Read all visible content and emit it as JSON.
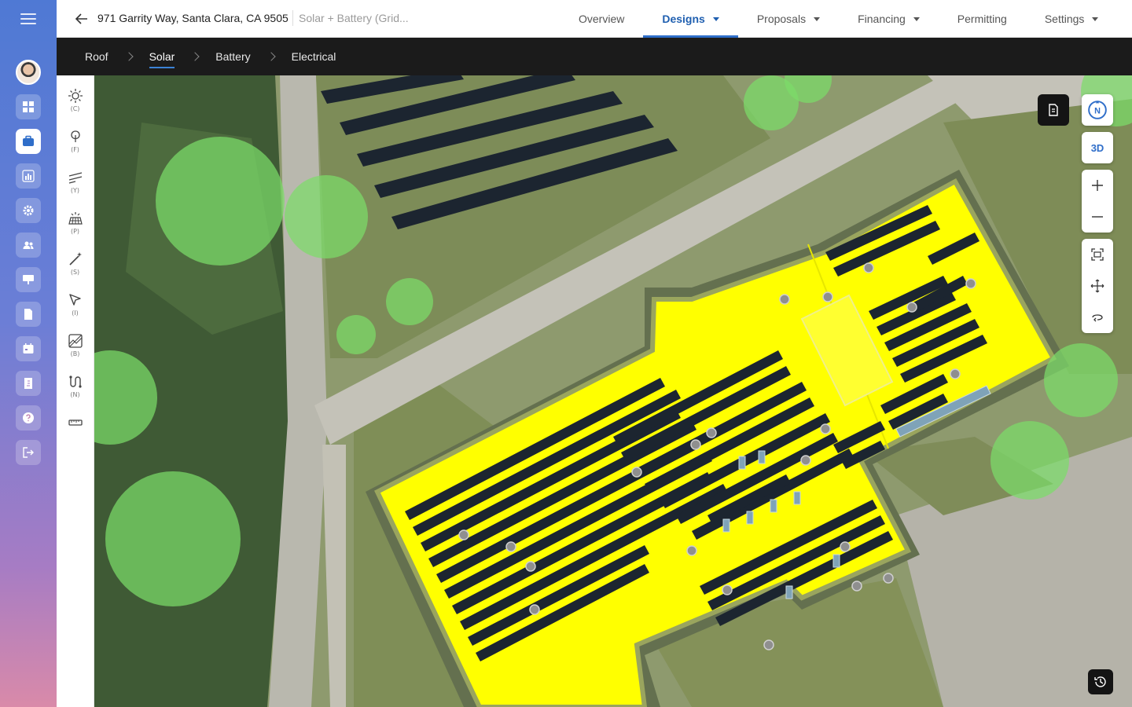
{
  "header": {
    "address": "971 Garrity Way, Santa Clara, CA 9505",
    "project": "Solar + Battery (Grid...",
    "tabs": [
      {
        "label": "Overview",
        "dropdown": false
      },
      {
        "label": "Designs",
        "dropdown": true,
        "active": true
      },
      {
        "label": "Proposals",
        "dropdown": true
      },
      {
        "label": "Financing",
        "dropdown": true
      },
      {
        "label": "Permitting",
        "dropdown": false
      },
      {
        "label": "Settings",
        "dropdown": true
      }
    ]
  },
  "subnav": {
    "steps": [
      "Roof",
      "Solar",
      "Battery",
      "Electrical"
    ],
    "active": "Solar"
  },
  "tools": [
    {
      "icon": "sun-icon",
      "key": "(C)"
    },
    {
      "icon": "tree-icon",
      "key": "(F)"
    },
    {
      "icon": "setback-lines-icon",
      "key": "(Y)"
    },
    {
      "icon": "solar-panel-icon",
      "key": "(P)"
    },
    {
      "icon": "magic-wand-icon",
      "key": "(S)"
    },
    {
      "icon": "select-cursor-icon",
      "key": "(I)"
    },
    {
      "icon": "irradiance-icon",
      "key": "(B)"
    },
    {
      "icon": "string-icon",
      "key": "(N)"
    },
    {
      "icon": "ruler-icon",
      "key": ""
    }
  ],
  "map_controls": {
    "compass": "N",
    "view_3d": "3D"
  },
  "colors": {
    "accent": "#2f6ec9",
    "roof_fill": "#ffff00",
    "tree_overlay": "#7cdc6a",
    "panel": "#1c2530"
  }
}
